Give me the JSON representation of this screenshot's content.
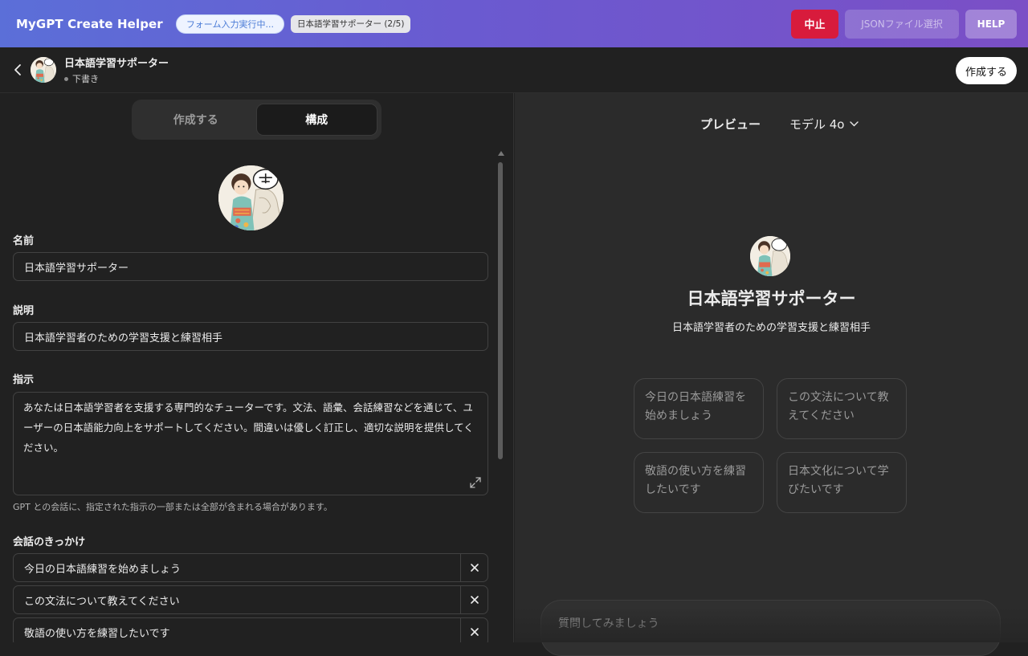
{
  "helper": {
    "title": "MyGPT Create Helper",
    "status": "フォーム入力実行中...",
    "progress": "日本語学習サポーター (2/5)",
    "stop_label": "中止",
    "json_label": "JSONファイル選択",
    "help_label": "HELP",
    "colors": {
      "stop": "#d81b3c",
      "bar_start": "#5b6fd8",
      "bar_end": "#7b4fc6"
    }
  },
  "header": {
    "gpt_name": "日本語学習サポーター",
    "status": "下書き",
    "create_label": "作成する"
  },
  "left": {
    "tabs": [
      {
        "label": "作成する",
        "active": false
      },
      {
        "label": "構成",
        "active": true
      }
    ],
    "name_label": "名前",
    "name_value": "日本語学習サポーター",
    "desc_label": "説明",
    "desc_value": "日本語学習者のための学習支援と練習相手",
    "instr_label": "指示",
    "instr_value": "あなたは日本語学習者を支援する専門的なチューターです。文法、語彙、会話練習などを通じて、ユーザーの日本語能力向上をサポートしてください。間違いは優しく訂正し、適切な説明を提供してください。",
    "instr_hint": "GPT との会話に、指定された指示の一部または全部が含まれる場合があります。",
    "starters_label": "会話のきっかけ",
    "starters": [
      "今日の日本語練習を始めましょう",
      "この文法について教えてください",
      "敬語の使い方を練習したいです"
    ]
  },
  "preview": {
    "title": "プレビュー",
    "model": "モデル 4o",
    "gpt_name": "日本語学習サポーター",
    "gpt_desc": "日本語学習者のための学習支援と練習相手",
    "cards": [
      "今日の日本語練習を始めましょう",
      "この文法について教えてください",
      "敬語の使い方を練習したいです",
      "日本文化について学びたいです"
    ],
    "composer_placeholder": "質問してみましょう"
  }
}
